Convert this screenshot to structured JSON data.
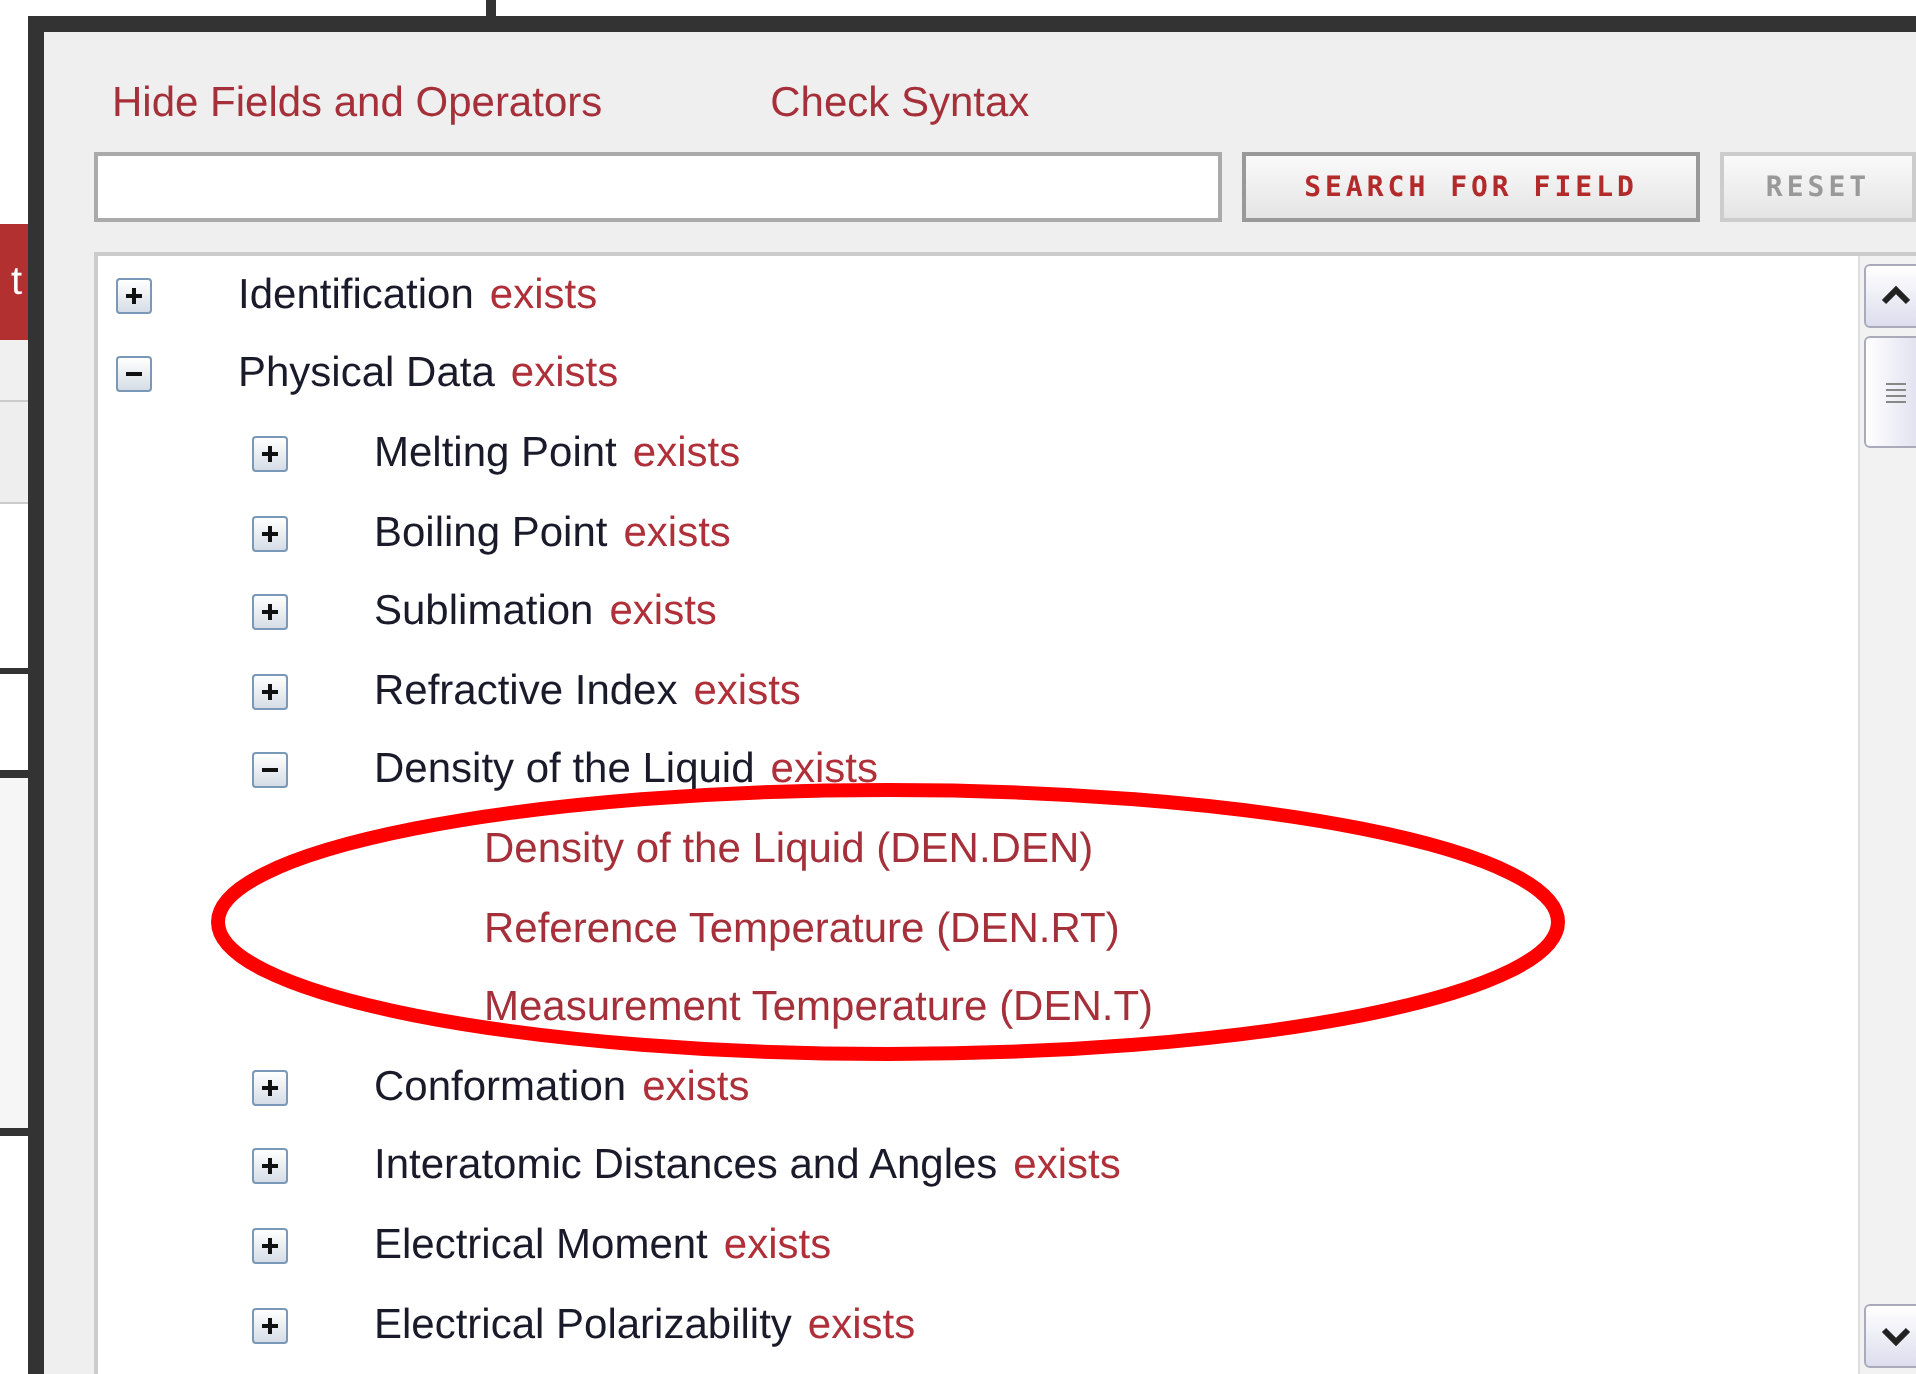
{
  "background_window": {
    "header_text": "t"
  },
  "links": [
    "Hide Fields and Operators",
    "Check Syntax"
  ],
  "buttons": [
    {
      "label": "SEARCH FOR FIELD",
      "disabled": false
    },
    {
      "label": "RESET",
      "disabled": true
    }
  ],
  "tree": [
    {
      "kind": "group",
      "label": "Identification",
      "suffix": "exists",
      "expanded": false
    },
    {
      "kind": "group",
      "label": "Physical Data",
      "suffix": "exists",
      "expanded": true,
      "children": [
        {
          "kind": "group",
          "label": "Melting Point",
          "suffix": "exists",
          "expanded": false
        },
        {
          "kind": "group",
          "label": "Boiling Point",
          "suffix": "exists",
          "expanded": false
        },
        {
          "kind": "group",
          "label": "Sublimation",
          "suffix": "exists",
          "expanded": false
        },
        {
          "kind": "group",
          "label": "Refractive Index",
          "suffix": "exists",
          "expanded": false
        },
        {
          "kind": "group",
          "label": "Density of the Liquid",
          "suffix": "exists",
          "expanded": true,
          "children": [
            {
              "kind": "field",
              "label": "Density of the Liquid (DEN.DEN)"
            },
            {
              "kind": "field",
              "label": "Reference Temperature (DEN.RT)"
            },
            {
              "kind": "field",
              "label": "Measurement Temperature (DEN.T)"
            }
          ]
        },
        {
          "kind": "group",
          "label": "Conformation",
          "suffix": "exists",
          "expanded": false
        },
        {
          "kind": "group",
          "label": "Interatomic Distances and Angles",
          "suffix": "exists",
          "expanded": false
        },
        {
          "kind": "group",
          "label": "Electrical Moment",
          "suffix": "exists",
          "expanded": false
        },
        {
          "kind": "group",
          "label": "Electrical Polarizability",
          "suffix": "exists",
          "expanded": false
        }
      ]
    }
  ]
}
